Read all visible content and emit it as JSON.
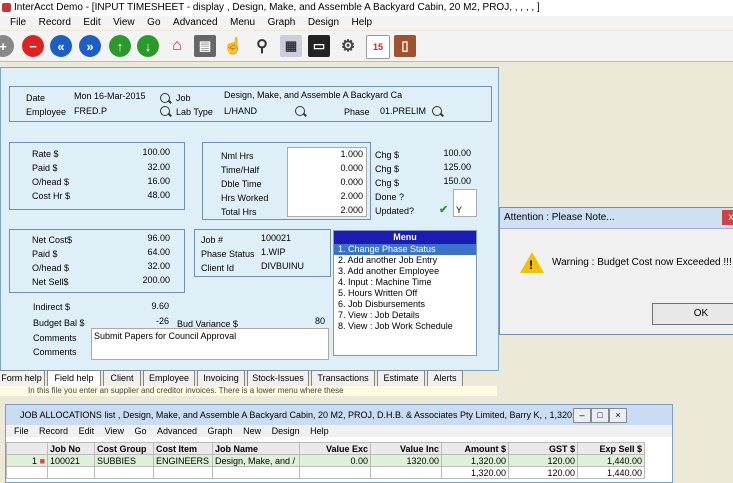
{
  "window": {
    "title": "InterAcct Demo - [INPUT TIMESHEET - display , Design, Make, and Assemble A Backyard Cabin, 20 M2, PROJ, , , , , ]"
  },
  "menubar": [
    "File",
    "Record",
    "Edit",
    "View",
    "Go",
    "Advanced",
    "Menu",
    "Graph",
    "Design",
    "Help"
  ],
  "header": {
    "date_label": "Date",
    "date_value": "Mon 16-Mar-2015",
    "employee_label": "Employee",
    "employee_value": "FRED.P",
    "job_label": "Job",
    "job_value": "Design, Make, and Assemble A Backyard Ca",
    "labtype_label": "Lab Type",
    "labtype_value": "L/HAND",
    "phase_label": "Phase",
    "phase_value": "01.PRELIM"
  },
  "rates": {
    "rate_label": "Rate  $",
    "rate_value": "100.00",
    "paid_label": "Paid  $",
    "paid_value": "32.00",
    "ohead_label": "O/head  $",
    "ohead_value": "16.00",
    "costhr_label": "Cost Hr $",
    "costhr_value": "48.00"
  },
  "hours": {
    "nml_label": "Nml Hrs",
    "nml_value": "1.000",
    "half_label": "Time/Half",
    "half_value": "0.000",
    "dble_label": "Dble Time",
    "dble_value": "0.000",
    "worked_label": "Hrs Worked",
    "worked_value": "2.000",
    "total_label": "Total Hrs",
    "total_value": "2.000"
  },
  "charges": {
    "chg1_label": "Chg $",
    "chg1_value": "100.00",
    "chg2_label": "Chg $",
    "chg2_value": "125.00",
    "chg3_label": "Chg $",
    "chg3_value": "150.00",
    "done_label": "Done ?",
    "updated_label": "Updated?",
    "updated_value": "Y"
  },
  "net": {
    "netcost_label": "Net Cost$",
    "netcost_value": "96.00",
    "paid_label": "Paid  $",
    "paid_value": "64.00",
    "ohead_label": "O/head  $",
    "ohead_value": "32.00",
    "netsell_label": "Net Sell$",
    "netsell_value": "200.00"
  },
  "job": {
    "jobno_label": "Job #",
    "jobno_value": "100021",
    "status_label": "Phase Status",
    "status_value": "1.WIP",
    "client_label": "Client Id",
    "client_value": "DIVBUINU"
  },
  "bottom": {
    "indirect_label": "Indirect $",
    "indirect_value": "9.60",
    "budgetbal_label": "Budget Bal $",
    "budgetbal_value": "-26",
    "budvar_label": "Bud Variance $",
    "budvar_value": "80",
    "comments_label": "Comments",
    "comments_value": "Submit Papers for Council Approval",
    "comments2_label": "Comments"
  },
  "menu_panel": {
    "title": "Menu",
    "items": [
      "1. Change Phase Status",
      "2. Add another Job Entry",
      "3. Add another Employee",
      "4. Input : Machine Time",
      "5. Hours Written Off",
      "6. Job Disbursements",
      "7. View : Job Details",
      "8. View : Job Work Schedule"
    ]
  },
  "tabs": [
    "Form help",
    "Field help",
    "Client",
    "Employee",
    "Invoicing",
    "Stock-Issues",
    "Transactions",
    "Estimate",
    "Alerts"
  ],
  "hint": "In this file you enter an supplier and creditor invoices.  There is a lower menu where these",
  "dialog": {
    "title": "Attention : Please Note...",
    "close": "x",
    "message": "Warning : Budget Cost now Exceeded !!!",
    "ok": "OK"
  },
  "jobwin": {
    "title": "JOB ALLOCATIONS list , Design, Make, and Assemble A Backyard Cabin, 20 M2, PROJ, D.H.B. & Associates Pty Limited, Barry K, , 1,320.00",
    "menu": [
      "File",
      "Record",
      "Edit",
      "View",
      "Go",
      "Advanced",
      "Graph",
      "New",
      "Design",
      "Help"
    ],
    "columns": [
      "Job No",
      "Cost Group",
      "Cost Item",
      "Job Name",
      "Value Exc",
      "Value Inc",
      "Amount  $",
      "GST $",
      "Exp Sell $"
    ],
    "row": {
      "num": "1",
      "jobno": "100021",
      "costgroup": "SUBBIES",
      "costitem": "ENGINEERS",
      "jobname": "Design, Make, and /",
      "valexc": "0.00",
      "valinc": "1320.00",
      "amount": "1,320.00",
      "gst": "120.00",
      "expsell": "1,440.00"
    },
    "totals": {
      "amount": "1,320.00",
      "gst": "120.00",
      "expsell": "1,440.00"
    }
  }
}
